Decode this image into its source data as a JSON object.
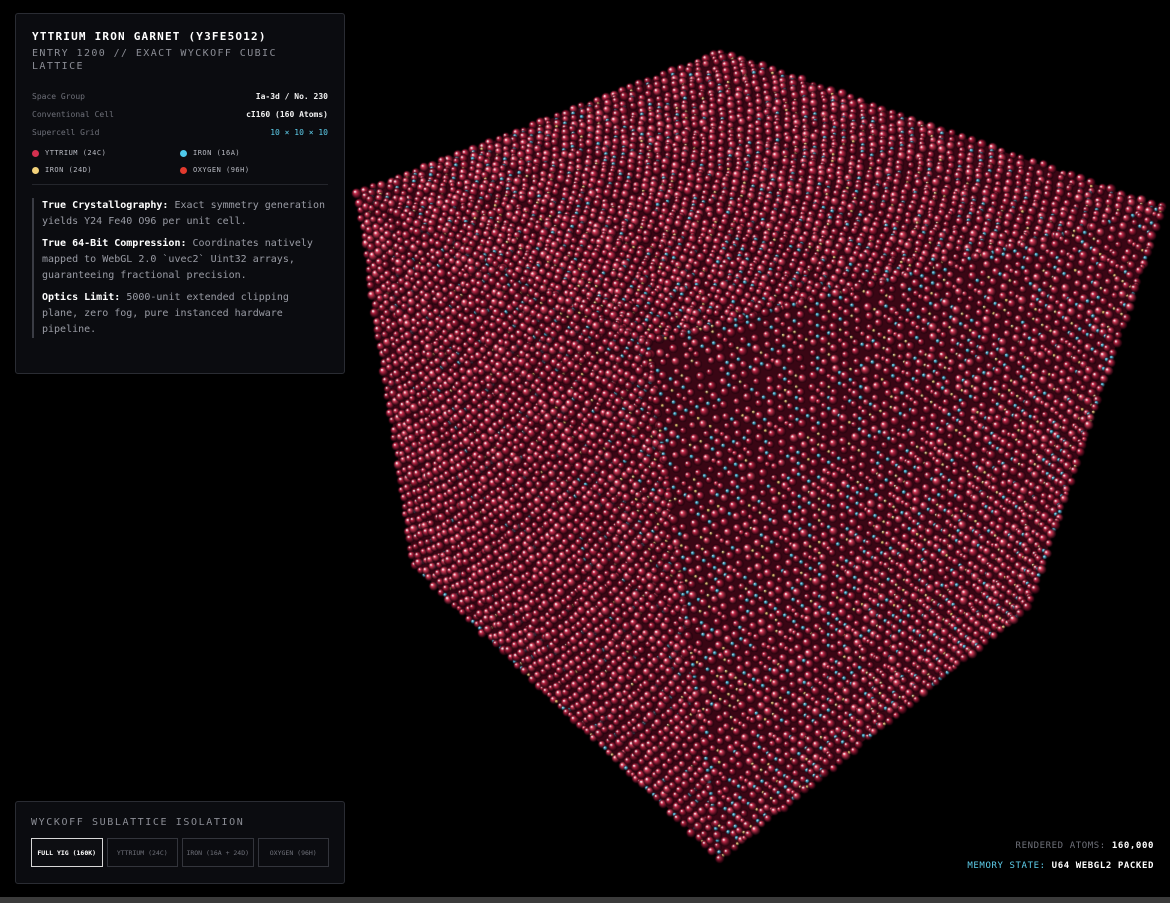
{
  "info": {
    "title": "YTTRIUM IRON GARNET (Y3FE5O12)",
    "subtitle": "ENTRY 1200 // EXACT WYCKOFF CUBIC LATTICE",
    "properties": [
      {
        "label": "Space Group",
        "value": "Ia-3d / No. 230"
      },
      {
        "label": "Conventional Cell",
        "value": "cI160 (160 Atoms)"
      },
      {
        "label": "Supercell Grid",
        "value": "10 × 10 × 10"
      }
    ],
    "legend": [
      {
        "label": "YTTRIUM (24C)",
        "color": "#d4304f"
      },
      {
        "label": "IRON (16A)",
        "color": "#4ec8ea"
      },
      {
        "label": "IRON (24D)",
        "color": "#f3d27a"
      },
      {
        "label": "OXYGEN (96H)",
        "color": "#e23a2e"
      }
    ],
    "notes": [
      {
        "head": "True Crystallography:",
        "text": "Exact symmetry generation yields Y24 Fe40 O96 per unit cell."
      },
      {
        "head": "True 64-Bit Compression:",
        "text": "Coordinates natively mapped to WebGL 2.0 `uvec2` Uint32 arrays, guaranteeing fractional precision."
      },
      {
        "head": "Optics Limit:",
        "text": "5000-unit extended clipping plane, zero fog, pure instanced hardware pipeline."
      }
    ]
  },
  "isolation": {
    "title": "WYCKOFF SUBLATTICE ISOLATION",
    "buttons": [
      "FULL YIG (160K)",
      "YTTRIUM (24C)",
      "IRON (16A + 24D)",
      "OXYGEN (96H)"
    ],
    "active_index": 0
  },
  "status": {
    "atoms_label": "RENDERED ATOMS:",
    "atoms_value": "160,000",
    "memory_label": "MEMORY STATE:",
    "memory_value": "U64 WEBGL2 PACKED"
  }
}
